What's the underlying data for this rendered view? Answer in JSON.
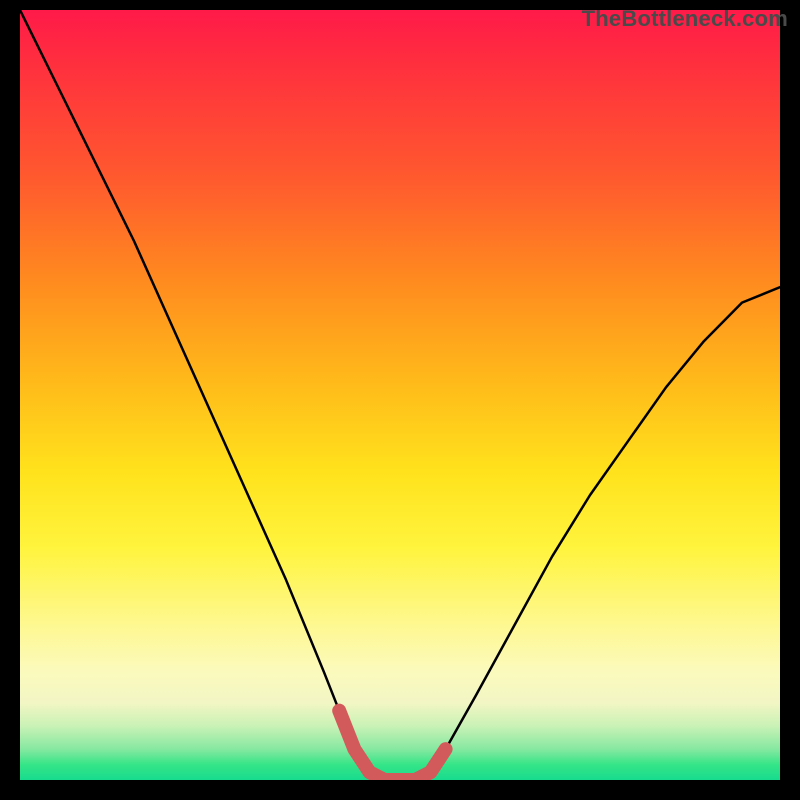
{
  "watermark": "TheBottleneck.com",
  "colors": {
    "background": "#000000",
    "curve_stroke": "#000000",
    "marker_stroke": "#d35a5a",
    "gradient_top": "#ff1a49",
    "gradient_bottom": "#17db8e"
  },
  "chart_data": {
    "type": "line",
    "title": "",
    "xlabel": "",
    "ylabel": "",
    "xlim": [
      0,
      100
    ],
    "ylim": [
      0,
      100
    ],
    "series": [
      {
        "name": "bottleneck-curve",
        "x": [
          0,
          5,
          10,
          15,
          20,
          25,
          30,
          35,
          40,
          42,
          44,
          46,
          48,
          50,
          52,
          54,
          56,
          60,
          65,
          70,
          75,
          80,
          85,
          90,
          95,
          100
        ],
        "y": [
          100,
          90,
          80,
          70,
          59,
          48,
          37,
          26,
          14,
          9,
          4,
          1,
          0,
          0,
          0,
          1,
          4,
          11,
          20,
          29,
          37,
          44,
          51,
          57,
          62,
          64
        ]
      },
      {
        "name": "sweet-spot-marker",
        "x": [
          42,
          44,
          46,
          48,
          50,
          52,
          54,
          56
        ],
        "y": [
          9,
          4,
          1,
          0,
          0,
          0,
          1,
          4
        ]
      }
    ]
  }
}
